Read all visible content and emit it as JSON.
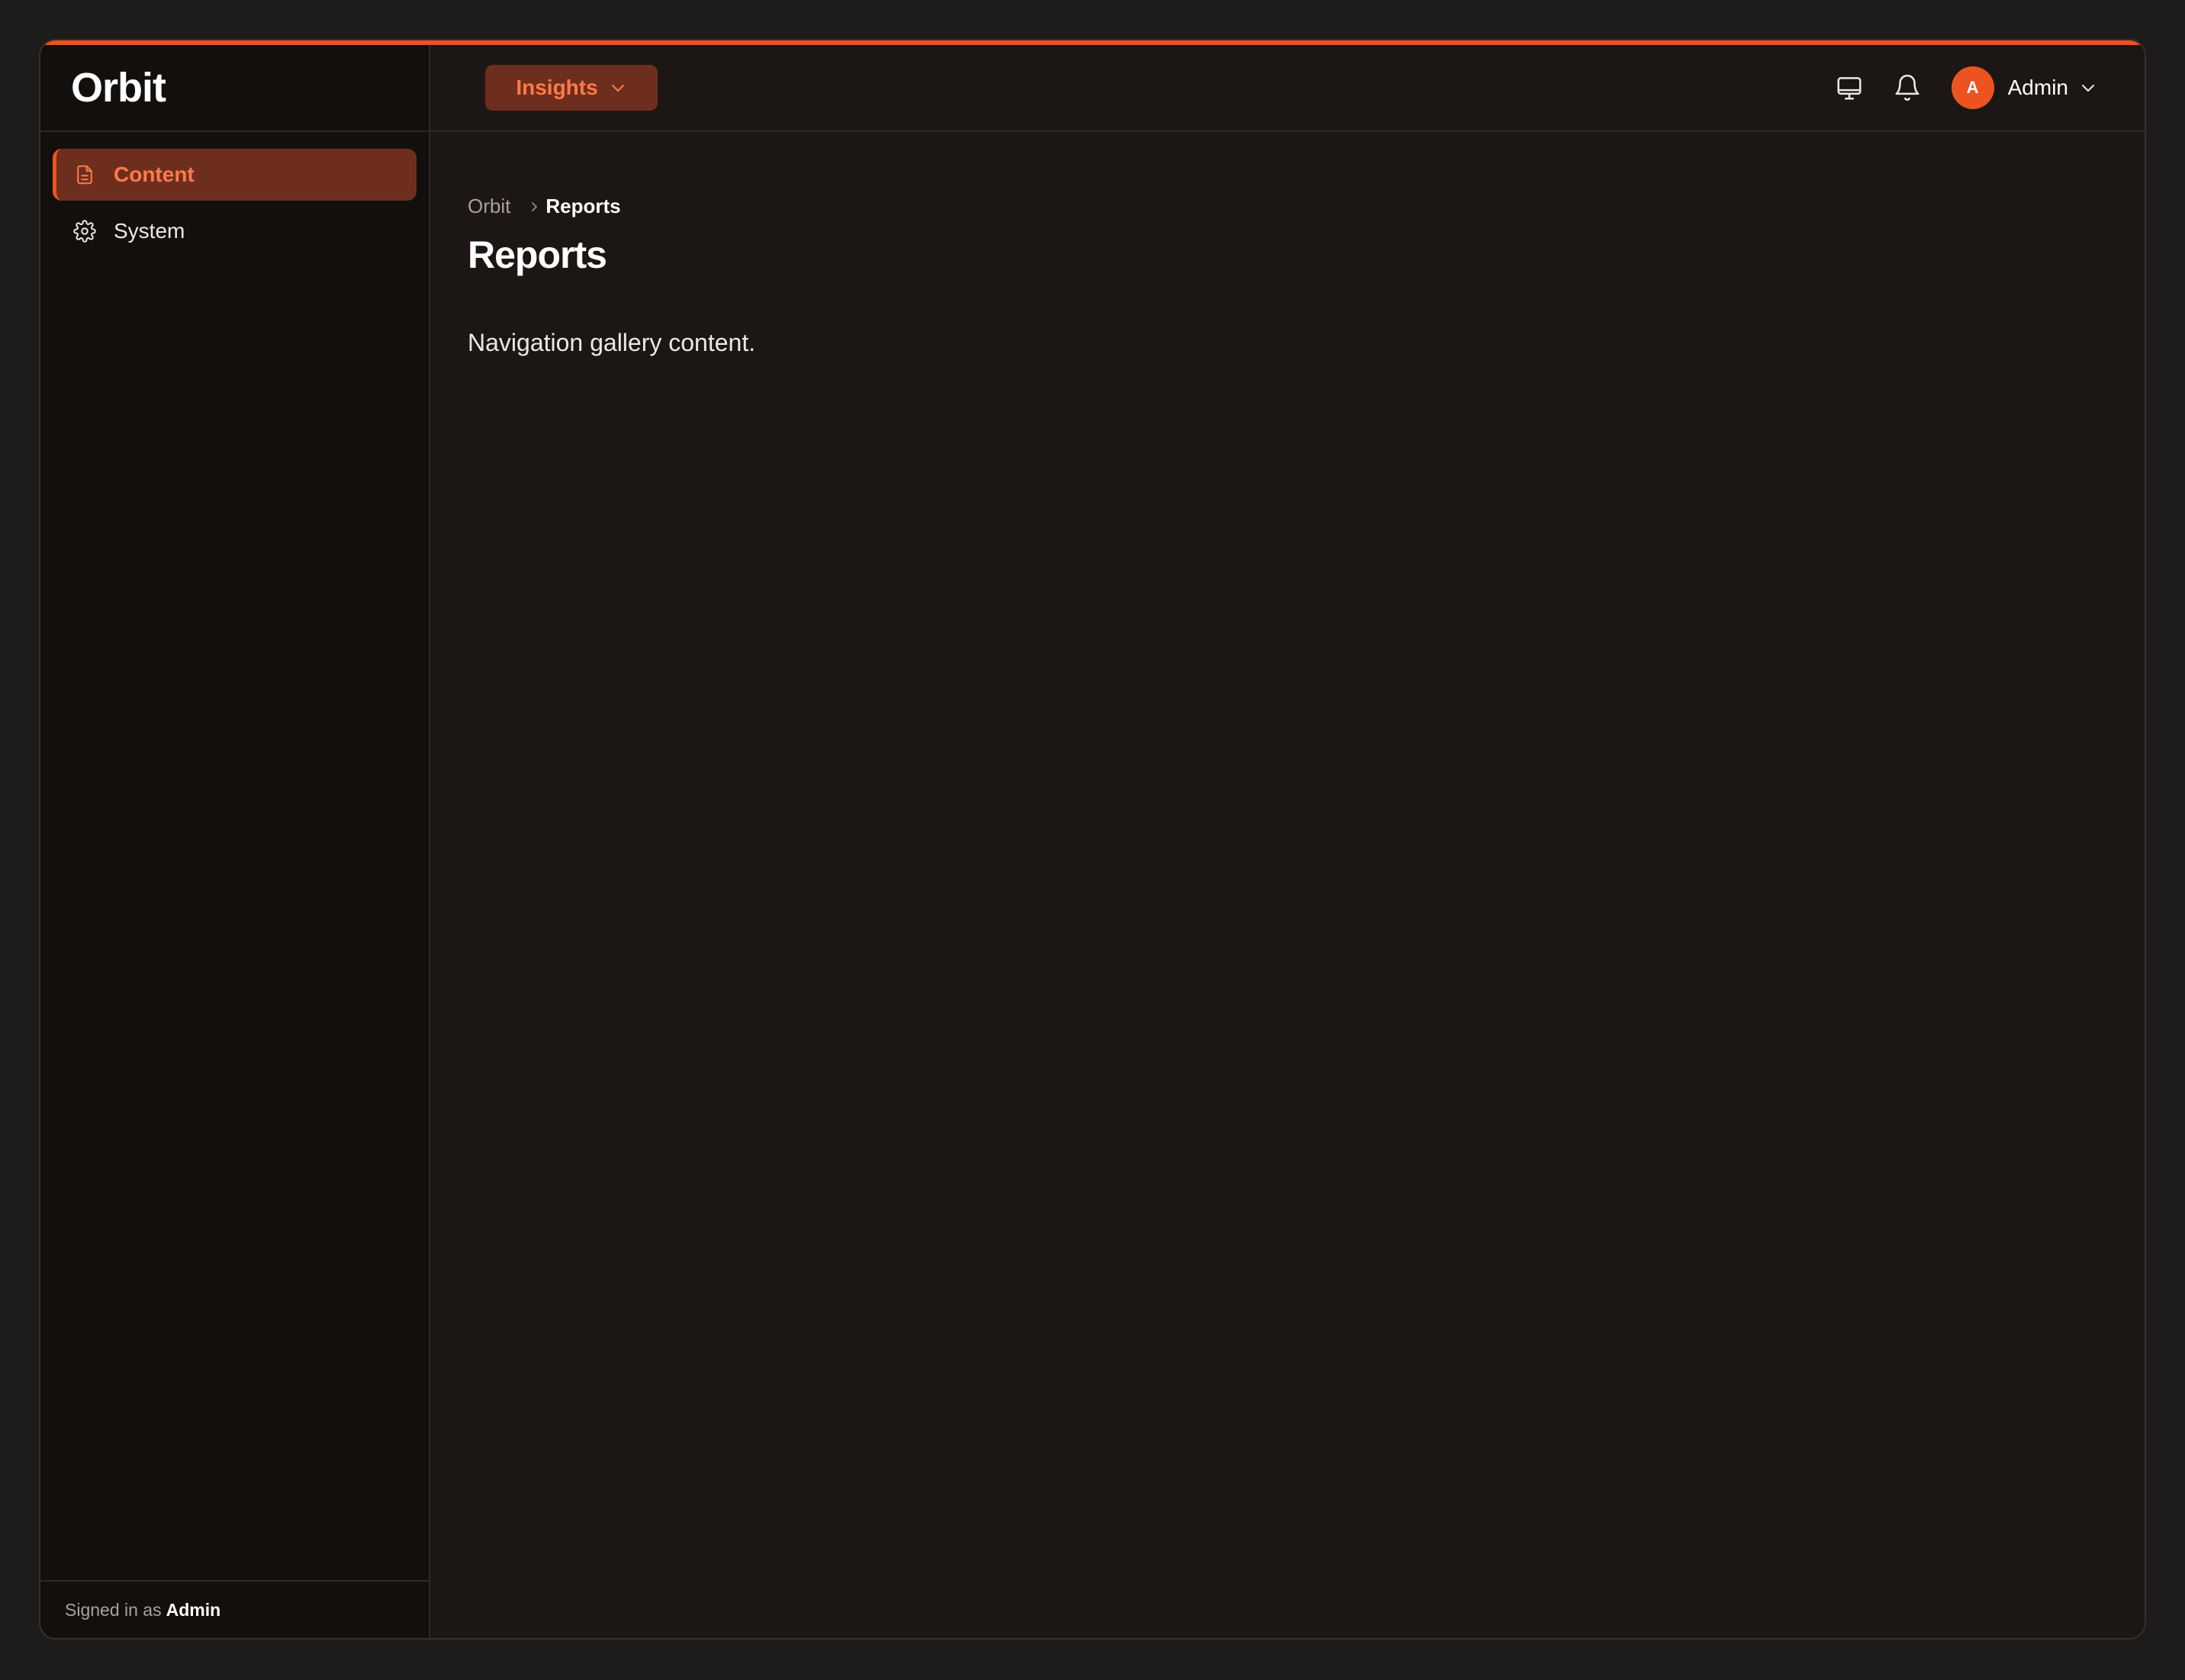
{
  "app": {
    "name": "Orbit"
  },
  "colors": {
    "accent": "#ec5321",
    "active_bg": "#6e2e1d",
    "active_text": "#ff7a4a"
  },
  "sidebar": {
    "items": [
      {
        "label": "Content",
        "icon": "file-icon",
        "active": true
      },
      {
        "label": "System",
        "icon": "gear-icon",
        "active": false
      }
    ],
    "footer": {
      "prefix": "Signed in as",
      "user": "Admin"
    }
  },
  "header": {
    "menu_label": "Insights",
    "icons": [
      "monitor-icon",
      "bell-icon"
    ],
    "avatar_initial": "A",
    "user_name": "Admin"
  },
  "breadcrumb": {
    "root": "Orbit",
    "current": "Reports"
  },
  "page": {
    "title": "Reports",
    "body": "Navigation gallery content."
  }
}
